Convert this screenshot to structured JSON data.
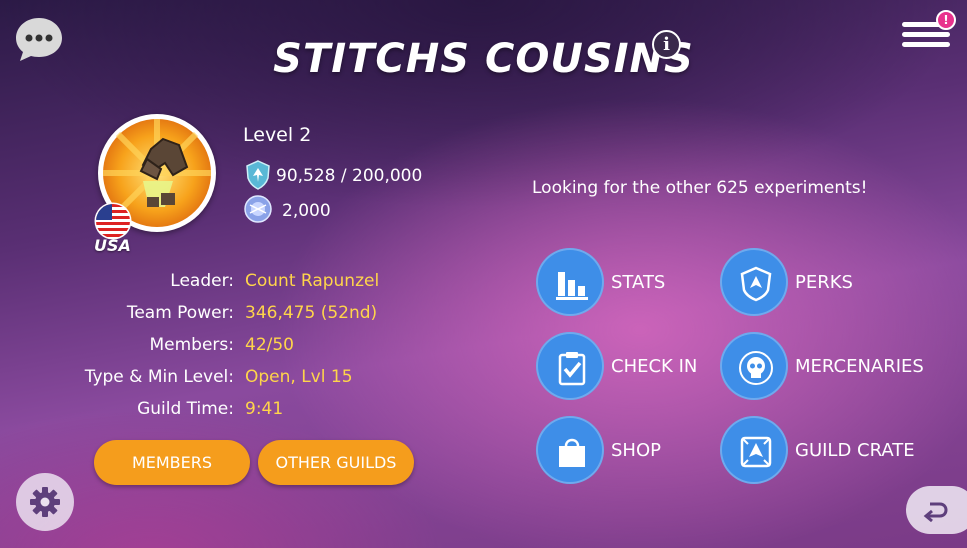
{
  "header": {
    "guild_name": "STITCHS COUSINS",
    "info_label": "i",
    "menu_badge": "!"
  },
  "profile": {
    "country": "USA",
    "level": "Level 2",
    "xp": "90,528 / 200,000",
    "gems": "2,000",
    "emblem_icon": "praying-hands-icon",
    "flag_icon": "usa-flag-icon"
  },
  "info": [
    {
      "key": "Leader:",
      "value": "Count Rapunzel"
    },
    {
      "key": "Team Power:",
      "value": "346,475 (52nd)"
    },
    {
      "key": "Members:",
      "value": "42/50"
    },
    {
      "key": "Type & Min Level:",
      "value": "Open, Lvl 15"
    },
    {
      "key": "Guild Time:",
      "value": "9:41"
    }
  ],
  "buttons": {
    "members": "MEMBERS",
    "other_guilds": "OTHER GUILDS"
  },
  "tagline": "Looking for the other 625 experiments!",
  "actions": {
    "stats": "STATS",
    "perks": "PERKS",
    "check_in": "CHECK IN",
    "mercenaries": "MERCENARIES",
    "shop": "SHOP",
    "guild_crate": "GUILD CRATE"
  },
  "colors": {
    "accent_orange": "#f59d1c",
    "value_yellow": "#ffd54a",
    "action_blue": "#3e8ee8",
    "badge_pink": "#e8338d"
  }
}
